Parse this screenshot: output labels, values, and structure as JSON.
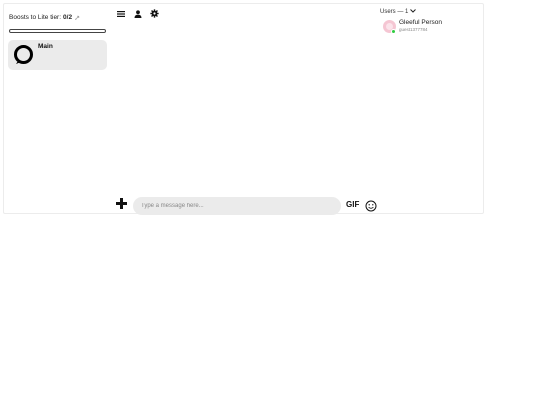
{
  "sidebar": {
    "boosts_label": "Boosts to Lite tier:",
    "boosts_count": "0/2",
    "boost_progress": 0,
    "channels": [
      {
        "name": "Main",
        "icon": "ring-icon"
      }
    ]
  },
  "toolbar": {
    "items": [
      {
        "icon": "menu-icon"
      },
      {
        "icon": "user-icon"
      },
      {
        "icon": "gear-icon"
      }
    ]
  },
  "users": {
    "header": "Users — 1",
    "list": [
      {
        "name": "Gleeful Person",
        "id": "guest1377784",
        "status": "online",
        "status_color": "#2ecc40",
        "avatar_color": "#f5c6d3"
      }
    ]
  },
  "composer": {
    "placeholder": "Type a message here...",
    "gif_label": "GIF"
  },
  "colors": {
    "channel_bg": "#ebebeb",
    "input_bg": "#ebebeb",
    "online": "#2ecc40"
  }
}
